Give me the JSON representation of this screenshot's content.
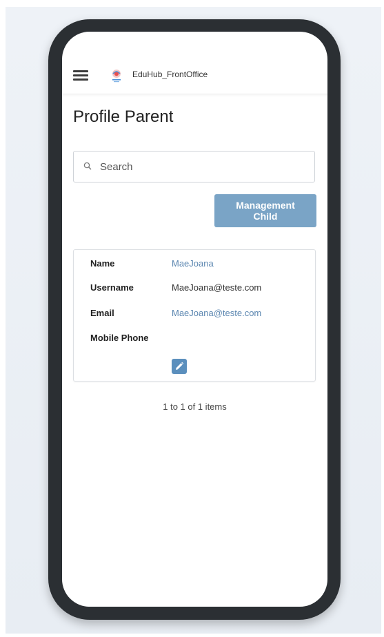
{
  "app": {
    "title": "EduHub_FrontOffice",
    "logo_icon": "eduhub-logo-icon"
  },
  "header": {
    "menu_icon": "hamburger-menu-icon"
  },
  "page": {
    "title": "Profile Parent"
  },
  "search": {
    "placeholder": "Search",
    "value": "",
    "icon": "search-icon"
  },
  "actions": {
    "management_child_label": "Management\nChild"
  },
  "profile": {
    "fields": [
      {
        "label": "Name",
        "value": "MaeJoana"
      },
      {
        "label": "Username",
        "value": "MaeJoana@teste.com"
      },
      {
        "label": "Email",
        "value": "MaeJoana@teste.com"
      },
      {
        "label": "Mobile Phone",
        "value": ""
      }
    ],
    "edit_icon": "pencil-icon"
  },
  "pagination": {
    "summary": "1 to 1 of 1 items"
  },
  "colors": {
    "accent": "#5b8fbd",
    "button": "#7aa4c6",
    "link": "#5b86b0",
    "phone_frame": "#2b2f33"
  }
}
